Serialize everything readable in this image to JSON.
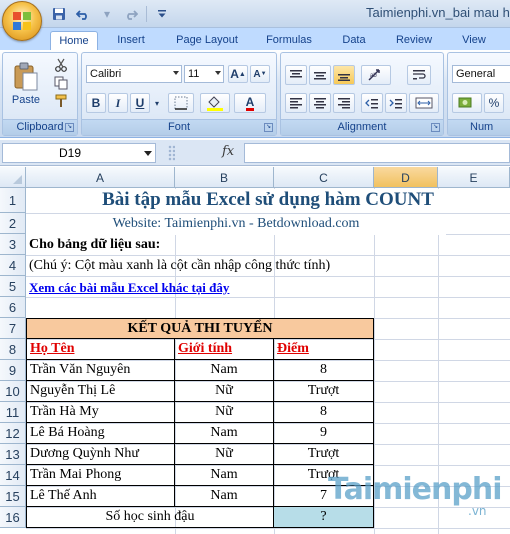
{
  "window": {
    "title": "Taimienphi.vn_bai mau han"
  },
  "quick_access": {
    "save": "save-icon",
    "undo": "undo-icon",
    "redo": "redo-icon",
    "customize": "dropdown-icon"
  },
  "ribbon": {
    "tabs": [
      "Home",
      "Insert",
      "Page Layout",
      "Formulas",
      "Data",
      "Review",
      "View"
    ],
    "active_tab": "Home",
    "clipboard": {
      "label": "Clipboard",
      "paste": "Paste"
    },
    "font": {
      "label": "Font",
      "family": "Calibri",
      "size": "11",
      "bold": "B",
      "italic": "I",
      "underline": "U",
      "grow": "A",
      "shrink": "A",
      "color": "A"
    },
    "alignment": {
      "label": "Alignment"
    },
    "number": {
      "label": "Num",
      "format": "General",
      "percent": "%"
    }
  },
  "formula_bar": {
    "name_box": "D19",
    "fx": "fx",
    "formula": ""
  },
  "grid": {
    "columns": [
      "A",
      "B",
      "C",
      "D",
      "E"
    ],
    "selected_column": "D",
    "rows": [
      "1",
      "2",
      "3",
      "4",
      "5",
      "6",
      "7",
      "8",
      "9",
      "10",
      "11",
      "12",
      "13",
      "14",
      "15",
      "16"
    ]
  },
  "sheet": {
    "title": "Bài tập mẫu Excel sử dụng hàm COUNT",
    "website": "Website: Taimienphi.vn - Betdownload.com",
    "given": "Cho bảng dữ liệu sau:",
    "note": "(Chú ý: Cột màu xanh là cột cần nhập công thức tính)",
    "link": "Xem các bài mẫu Excel khác tại đây",
    "table_title": "KẾT QUẢ THI TUYỂN",
    "headers": [
      "Họ Tên",
      "Giới tính",
      "Điểm"
    ],
    "records": [
      [
        "Trần Văn Nguyên",
        "Nam",
        "8"
      ],
      [
        "Nguyễn Thị Lê",
        "Nữ",
        "Trượt"
      ],
      [
        "Trần Hà My",
        "Nữ",
        "8"
      ],
      [
        "Lê Bá Hoàng",
        "Nam",
        "9"
      ],
      [
        "Dương Quỳnh Như",
        "Nữ",
        "Trượt"
      ],
      [
        "Trần Mai Phong",
        "Nam",
        "Trượt"
      ],
      [
        "Lê Thế Anh",
        "Nam",
        "7"
      ]
    ],
    "summary_label": "Số học sinh đậu",
    "summary_value": "?"
  },
  "watermark": {
    "text": "Taimienphi",
    "suffix": ".vn"
  },
  "colors": {
    "ribbon": "#bfdbff",
    "header_fill": "#f8c99e",
    "input_fill": "#b7dde8",
    "selected_column": "#f1c15f",
    "title_text": "#1f4e79",
    "header_text": "#e00000"
  }
}
